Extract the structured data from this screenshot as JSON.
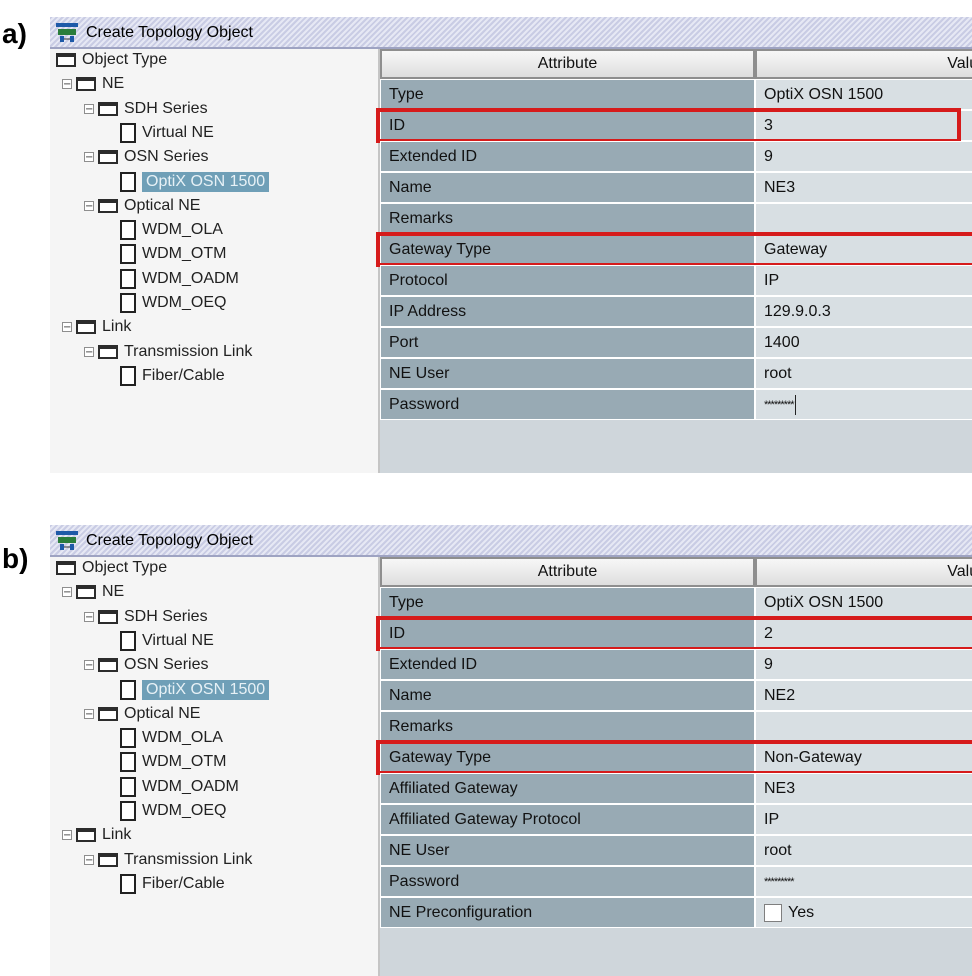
{
  "labels": {
    "a": "a)",
    "b": "b)"
  },
  "panels": [
    {
      "id": "a",
      "title": "Create Topology Object",
      "tree": [
        {
          "label": "Object Type",
          "level": 0,
          "kind": "folder"
        },
        {
          "label": "NE",
          "level": 1,
          "kind": "folder",
          "toggle": "⊟"
        },
        {
          "label": "SDH Series",
          "level": 2,
          "kind": "folder",
          "toggle": "⊟"
        },
        {
          "label": "Virtual NE",
          "level": 3,
          "kind": "file"
        },
        {
          "label": "OSN Series",
          "level": 2,
          "kind": "folder",
          "toggle": "⊟"
        },
        {
          "label": "OptiX OSN 1500",
          "level": 3,
          "kind": "file",
          "selected": true
        },
        {
          "label": "Optical NE",
          "level": 2,
          "kind": "folder",
          "toggle": "⊟"
        },
        {
          "label": "WDM_OLA",
          "level": 3,
          "kind": "file"
        },
        {
          "label": "WDM_OTM",
          "level": 3,
          "kind": "file"
        },
        {
          "label": "WDM_OADM",
          "level": 3,
          "kind": "file"
        },
        {
          "label": "WDM_OEQ",
          "level": 3,
          "kind": "file"
        },
        {
          "label": "Link",
          "level": 1,
          "kind": "folder",
          "toggle": "⊟"
        },
        {
          "label": "Transmission Link",
          "level": 2,
          "kind": "folder",
          "toggle": "⊟"
        },
        {
          "label": "Fiber/Cable",
          "level": 3,
          "kind": "file"
        }
      ],
      "header": {
        "attribute": "Attribute",
        "value": "Value"
      },
      "rows": [
        {
          "attr": "Type",
          "value": "OptiX OSN 1500"
        },
        {
          "attr": "ID",
          "value": "3",
          "highlight": true
        },
        {
          "attr": "Extended ID",
          "value": "9"
        },
        {
          "attr": "Name",
          "value": "NE3"
        },
        {
          "attr": "Remarks",
          "value": ""
        },
        {
          "attr": "Gateway Type",
          "value": "Gateway",
          "highlight": true
        },
        {
          "attr": "Protocol",
          "value": "IP"
        },
        {
          "attr": "IP Address",
          "value": "129.9.0.3"
        },
        {
          "attr": "Port",
          "value": "1400"
        },
        {
          "attr": "NE User",
          "value": "root"
        },
        {
          "attr": "Password",
          "value": "*********",
          "caret": true
        }
      ]
    },
    {
      "id": "b",
      "title": "Create Topology Object",
      "tree": [
        {
          "label": "Object Type",
          "level": 0,
          "kind": "folder"
        },
        {
          "label": "NE",
          "level": 1,
          "kind": "folder",
          "toggle": "⊟"
        },
        {
          "label": "SDH Series",
          "level": 2,
          "kind": "folder",
          "toggle": "⊟"
        },
        {
          "label": "Virtual NE",
          "level": 3,
          "kind": "file"
        },
        {
          "label": "OSN Series",
          "level": 2,
          "kind": "folder",
          "toggle": "⊟"
        },
        {
          "label": "OptiX OSN 1500",
          "level": 3,
          "kind": "file",
          "selected": true
        },
        {
          "label": "Optical NE",
          "level": 2,
          "kind": "folder",
          "toggle": "⊟"
        },
        {
          "label": "WDM_OLA",
          "level": 3,
          "kind": "file"
        },
        {
          "label": "WDM_OTM",
          "level": 3,
          "kind": "file"
        },
        {
          "label": "WDM_OADM",
          "level": 3,
          "kind": "file"
        },
        {
          "label": "WDM_OEQ",
          "level": 3,
          "kind": "file"
        },
        {
          "label": "Link",
          "level": 1,
          "kind": "folder",
          "toggle": "⊟"
        },
        {
          "label": "Transmission Link",
          "level": 2,
          "kind": "folder",
          "toggle": "⊟"
        },
        {
          "label": "Fiber/Cable",
          "level": 3,
          "kind": "file"
        }
      ],
      "header": {
        "attribute": "Attribute",
        "value": "Value"
      },
      "rows": [
        {
          "attr": "Type",
          "value": "OptiX OSN 1500"
        },
        {
          "attr": "ID",
          "value": "2",
          "highlight": true
        },
        {
          "attr": "Extended ID",
          "value": "9"
        },
        {
          "attr": "Name",
          "value": "NE2"
        },
        {
          "attr": "Remarks",
          "value": ""
        },
        {
          "attr": "Gateway Type",
          "value": "Non-Gateway",
          "highlight": true
        },
        {
          "attr": "Affiliated Gateway",
          "value": "NE3"
        },
        {
          "attr": "Affiliated Gateway Protocol",
          "value": "IP"
        },
        {
          "attr": "NE User",
          "value": "root"
        },
        {
          "attr": "Password",
          "value": "*********"
        },
        {
          "attr": "NE Preconfiguration",
          "value": "Yes",
          "checkbox": true
        }
      ]
    }
  ],
  "colors": {
    "highlight": "#d61b1b",
    "attr_bg": "#98aab4",
    "value_bg": "#d8dfe3",
    "selected_bg": "#6f9fb7"
  }
}
